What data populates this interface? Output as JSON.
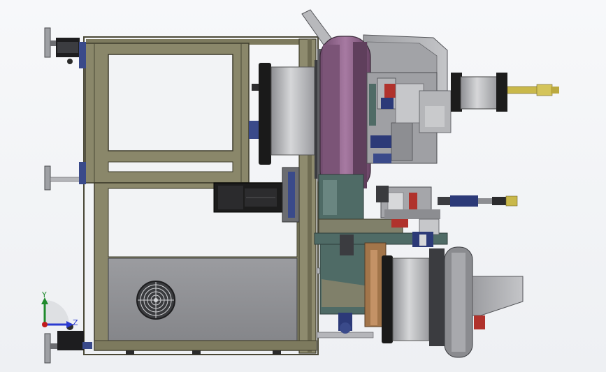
{
  "triad": {
    "y_label": "Y",
    "z_label": "Z"
  },
  "colors": {
    "background": "#f4f5f7",
    "frame": "#7d7a5e",
    "frame_dark": "#4a4836",
    "panel": "#8e8f93",
    "drum_light": "#c9cacc",
    "drum_dark": "#6e6f73",
    "ring_dark": "#1a1a1a",
    "purple_disc": "#8a5f86",
    "motor_black": "#1c1c1c",
    "yellow_rod": "#c9b84a",
    "blue_accent": "#2c3a78",
    "red_accent": "#b0322c",
    "teal_plate": "#4f6b66",
    "axis_y": "#1f8a2c",
    "axis_z": "#2a3ad0",
    "axis_x": "#c21b1b"
  },
  "icons": {
    "fan": "fan-grille-icon",
    "feet": "leveling-foot-icon",
    "axes": "coordinate-triad-icon"
  }
}
